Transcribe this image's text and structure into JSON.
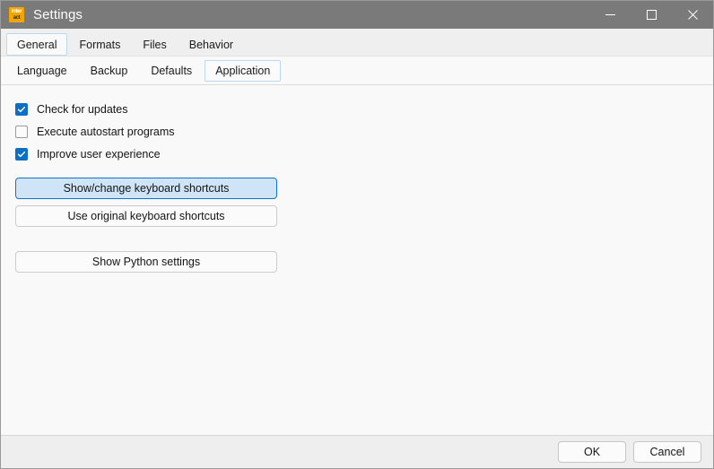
{
  "window": {
    "title": "Settings",
    "app_icon_line1": "inter",
    "app_icon_line2": "act",
    "controls": {
      "minimize": "minimize-icon",
      "maximize": "maximize-icon",
      "close": "close-icon"
    },
    "titlebar_color": "#7a7a7a"
  },
  "outer_tabs": {
    "selected": "General",
    "items": [
      {
        "label": "General"
      },
      {
        "label": "Formats"
      },
      {
        "label": "Files"
      },
      {
        "label": "Behavior"
      }
    ]
  },
  "inner_tabs": {
    "selected": "Application",
    "items": [
      {
        "label": "Language"
      },
      {
        "label": "Backup"
      },
      {
        "label": "Defaults"
      },
      {
        "label": "Application"
      }
    ]
  },
  "application": {
    "checkboxes": [
      {
        "label": "Check for updates",
        "checked": true
      },
      {
        "label": "Execute autostart programs",
        "checked": false
      },
      {
        "label": "Improve user experience",
        "checked": true
      }
    ],
    "buttons": [
      {
        "label": "Show/change keyboard shortcuts",
        "focused": true
      },
      {
        "label": "Use original keyboard shortcuts",
        "focused": false
      },
      {
        "label": "Show Python settings",
        "focused": false
      }
    ]
  },
  "footer": {
    "ok_label": "OK",
    "cancel_label": "Cancel"
  },
  "colors": {
    "accent": "#0c6fc4",
    "focus_fill": "#cfe4f7",
    "tab_focus_border": "#bcd9f2",
    "icon_orange": "#f0a500"
  }
}
